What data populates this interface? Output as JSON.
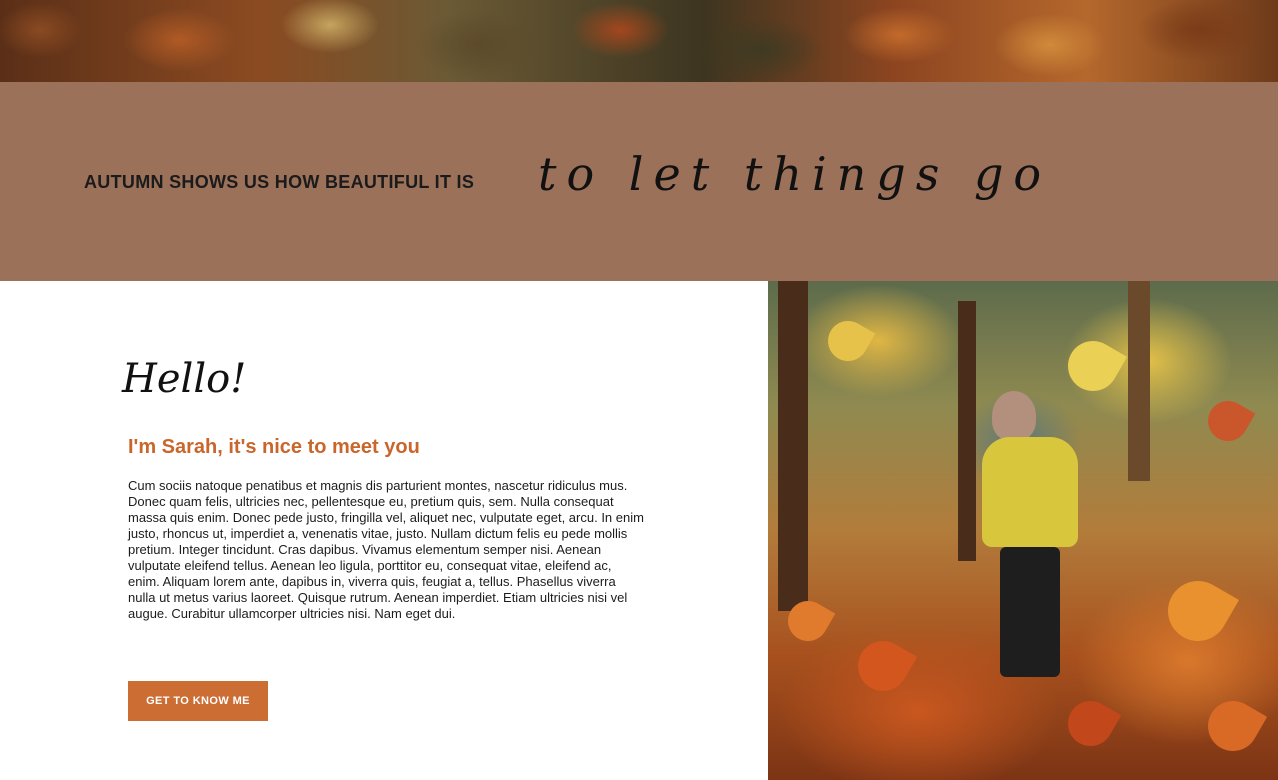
{
  "quote": {
    "text": "AUTUMN SHOWS US HOW BEAUTIFUL IT IS",
    "script": "to let things go"
  },
  "intro": {
    "greeting": "Hello!",
    "title": "I'm Sarah, it's nice to meet you",
    "body": "Cum sociis natoque penatibus et magnis dis parturient montes, nascetur ridiculus mus. Donec quam felis, ultricies nec, pellentesque eu, pretium quis, sem. Nulla consequat massa quis enim. Donec pede justo, fringilla vel, aliquet nec, vulputate eget, arcu. In enim justo, rhoncus ut, imperdiet a, venenatis vitae, justo. Nullam dictum felis eu pede mollis pretium. Integer tincidunt. Cras dapibus. Vivamus elementum semper nisi. Aenean vulputate eleifend tellus. Aenean leo ligula, porttitor eu, consequat vitae, eleifend ac, enim. Aliquam lorem ante, dapibus in, viverra quis, feugiat a, tellus. Phasellus viverra nulla ut metus varius laoreet. Quisque rutrum. Aenean imperdiet. Etiam ultricies nisi vel augue. Curabitur ullamcorper ultricies nisi. Nam eget dui.",
    "button_label": "GET TO KNOW ME"
  },
  "colors": {
    "band": "#9b715a",
    "accent": "#cc6d34",
    "title": "#c8662c"
  }
}
